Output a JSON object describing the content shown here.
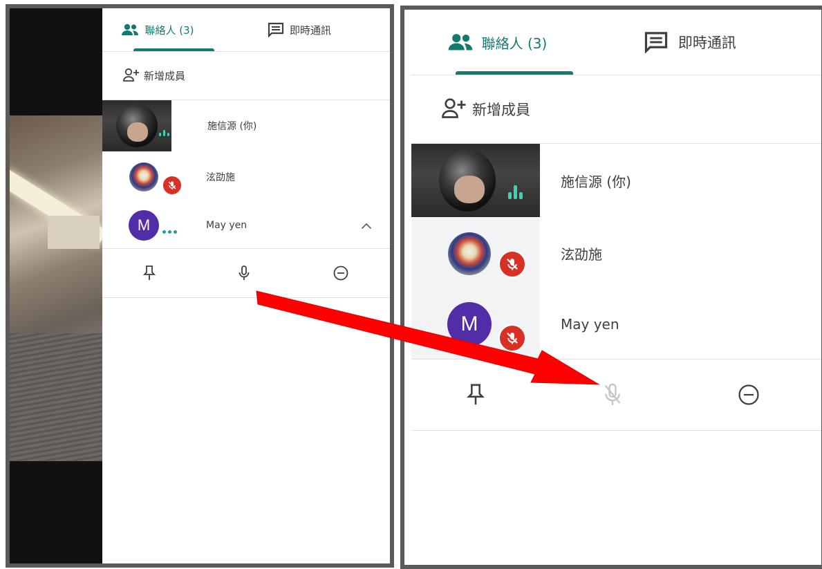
{
  "panels": [
    {
      "tabs": {
        "contacts": "聯絡人 (3)",
        "chat": "即時通訊"
      },
      "add_member": "新增成員",
      "participants": [
        {
          "name": "施信源 (你)",
          "avatar": "camera-feed",
          "muted": false,
          "speaking": true
        },
        {
          "name": "泫劭施",
          "avatar": "gundam-image",
          "muted": true
        },
        {
          "name": "May yen",
          "avatar_letter": "M",
          "muted": false,
          "speaking": true
        }
      ],
      "actions": [
        "pin-icon",
        "microphone-icon",
        "remove-icon"
      ]
    },
    {
      "tabs": {
        "contacts": "聯絡人 (3)",
        "chat": "即時通訊"
      },
      "add_member": "新增成員",
      "participants": [
        {
          "name": "施信源 (你)",
          "avatar": "camera-feed",
          "muted": false,
          "speaking": true
        },
        {
          "name": "泫劭施",
          "avatar": "gundam-image",
          "muted": true
        },
        {
          "name": "May yen",
          "avatar_letter": "M",
          "muted": true
        }
      ],
      "actions": [
        "pin-icon",
        "microphone-off-icon",
        "remove-icon"
      ]
    }
  ],
  "colors": {
    "accent": "#137a6f",
    "mute_red": "#d93025",
    "avatar_purple": "#512da8",
    "arrow_red": "#ff0000"
  }
}
